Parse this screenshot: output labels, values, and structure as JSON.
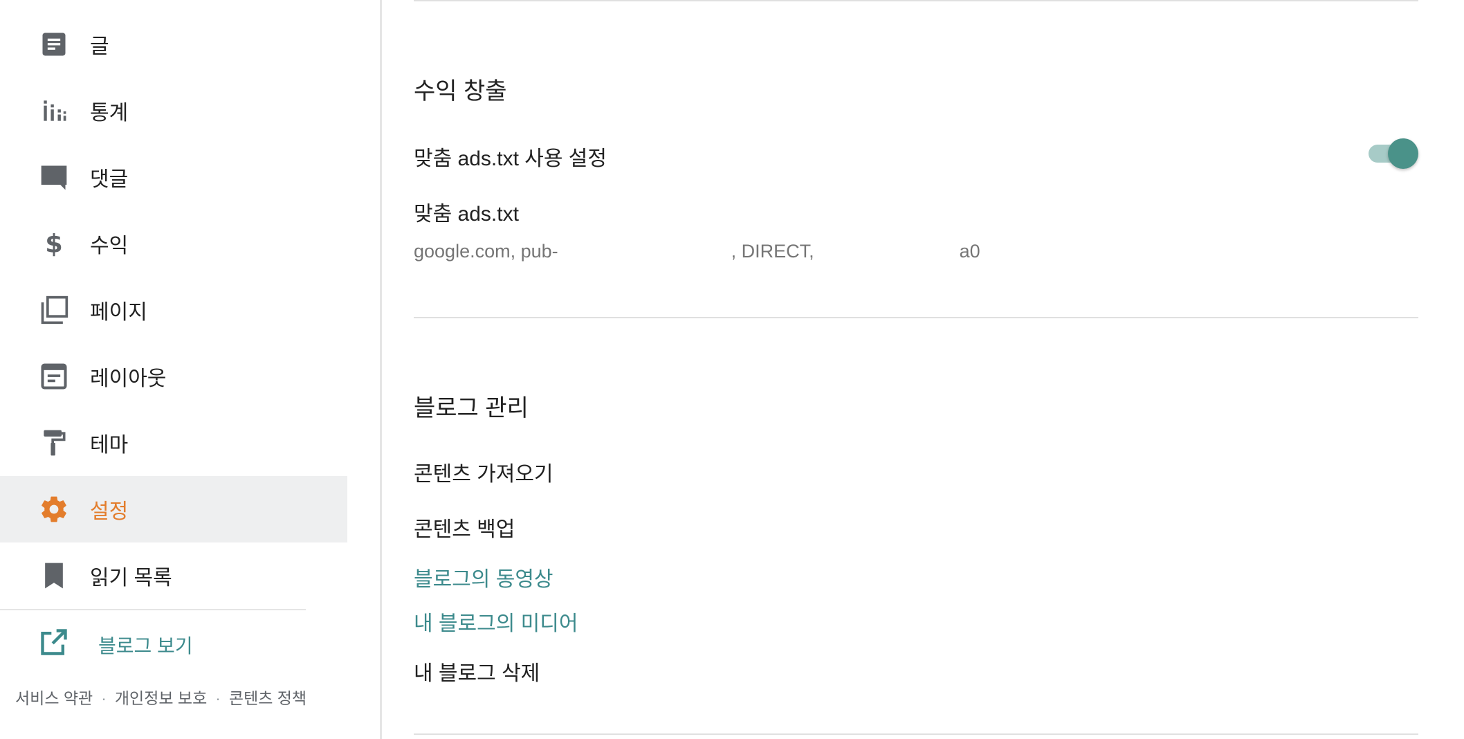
{
  "sidebar": {
    "items": [
      {
        "label": "글",
        "icon": "posts-icon"
      },
      {
        "label": "통계",
        "icon": "stats-icon"
      },
      {
        "label": "댓글",
        "icon": "comments-icon"
      },
      {
        "label": "수익",
        "icon": "dollar-icon"
      },
      {
        "label": "페이지",
        "icon": "pages-icon"
      },
      {
        "label": "레이아웃",
        "icon": "layout-icon"
      },
      {
        "label": "테마",
        "icon": "paint-roller-icon"
      },
      {
        "label": "설정",
        "icon": "gear-icon",
        "active": true
      },
      {
        "label": "읽기 목록",
        "icon": "bookmark-icon"
      }
    ],
    "view_blog": "블로그 보기",
    "footer": {
      "terms": "서비스 약관",
      "privacy": "개인정보 보호",
      "content_policy": "콘텐츠 정책"
    }
  },
  "monetization": {
    "title": "수익 창출",
    "custom_ads_enable_label": "맞춤 ads.txt 사용 설정",
    "custom_ads_enabled": true,
    "custom_ads_label": "맞춤 ads.txt",
    "ads_value_part1": "google.com, pub-",
    "ads_value_part2": ", DIRECT,",
    "ads_value_part3": "a0"
  },
  "blog_management": {
    "title": "블로그 관리",
    "import_content": "콘텐츠 가져오기",
    "backup_content": "콘텐츠 백업",
    "blog_videos": "블로그의 동영상",
    "blog_media": "내 블로그의 미디어",
    "delete_blog": "내 블로그 삭제"
  },
  "colors": {
    "accent_orange": "#e37d2c",
    "link_teal": "#3c8a8c",
    "icon_gray": "#5f6368",
    "toggle_on": "#4a9289"
  }
}
